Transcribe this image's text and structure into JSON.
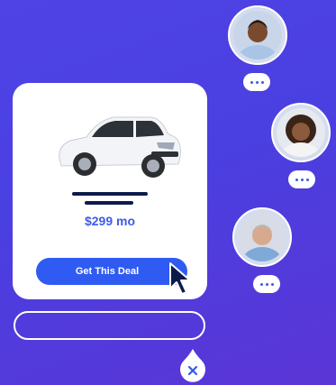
{
  "offer": {
    "price": "$299 mo",
    "cta_label": "Get This Deal",
    "product_image": "white hatchback car"
  },
  "chat": {
    "close_icon": "close-icon",
    "typing_indicator": "..."
  },
  "colors": {
    "background": "#4a3fe0",
    "accent": "#2f5bf3",
    "price": "#3d5ae8",
    "dark": "#0d1b4a"
  }
}
